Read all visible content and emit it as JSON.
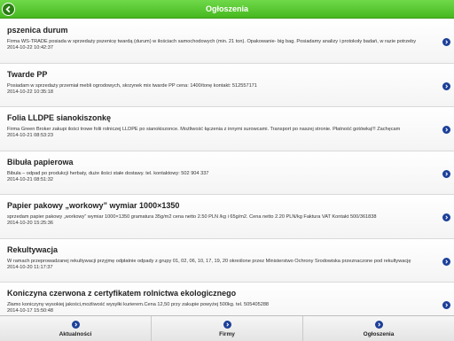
{
  "header": {
    "title": "Ogłoszenia",
    "back_icon": "back-arrow-icon"
  },
  "items": [
    {
      "title": "pszenica durum",
      "description": "Firma WS-TRADE posiada w sprzedaży pszenicę twardą (durum) w ilościach samochodowych (min. 21 ton). Opakowanie- big bag. Posiadamy analizy i protokoły badań, w razie potrzeby",
      "date": "2014-10-22 10:42:37"
    },
    {
      "title": "Twarde PP",
      "description": "Posiadam w sprzedaży przemiał mebli ogrodowych, skrzynek mix twarde PP cena: 1400/tonę kontakt: 512557171",
      "date": "2014-10-22 10:35:18"
    },
    {
      "title": "Folia LLDPE sianokiszonkę",
      "description": "Firma Green Broker zakupi ilości trowe folii rolniczej LLDPE po sianokiszonce. Możliwość łączenia z innymi surowcami. Transport po naszej stronie. Płatność gotówką!!! Zachęcam",
      "date": "2014-10-21 08:53:23"
    },
    {
      "title": "Bibuła papierowa",
      "description": "Bibuła – odpad po produkcji herbaty, duże ilości stałe dostawy. tel. kontaktowy: 502 904 337",
      "date": "2014-10-21 08:51:32"
    },
    {
      "title": "Papier pakowy „workowy” wymiar 1000×1350",
      "description": "sprzedam papier pakowy „workowy” wymiar 1000×1350 gramatura 35g/m2 cena netto 2.50 PLN /kg i 65g/m2. Cena netto 2.20 PLN/kg Faktura VAT Kontakt 500/361838",
      "date": "2014-10-20 15:25:36"
    },
    {
      "title": "Rekultywacja",
      "description": "W ramach przeprowadzanej rekultywacji przyjmę odpłatnie odpady z grupy 01, 02, 06, 10, 17, 19, 20 określone przez Ministerstwo Ochrony Środowiska przeznaczone pod rekultywację",
      "date": "2014-10-20 11:17:37"
    },
    {
      "title": "Koniczyna czerwona z certyfikatem rolnictwa ekologicznego",
      "description": "Złamo koniczyny wysokiej jakości,możliwość wysyłki kurierem.Cena 12,50 przy zakupie powyżej 500kg. tel. 505405288",
      "date": "2014-10-17 15:50:48"
    }
  ],
  "footer": {
    "tabs": [
      {
        "label": "Aktualności",
        "icon": "chevron-right-icon"
      },
      {
        "label": "Firmy",
        "icon": "chevron-right-icon"
      },
      {
        "label": "Ogłoszenia",
        "icon": "chevron-right-icon"
      }
    ]
  },
  "colors": {
    "header_green": "#46b81f",
    "icon_blue": "#1c3f99"
  }
}
